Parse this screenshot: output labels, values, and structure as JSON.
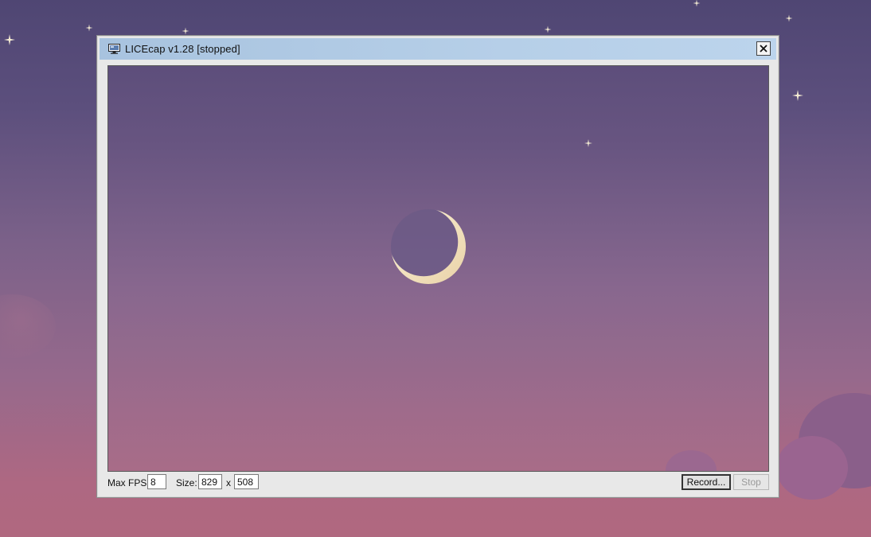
{
  "window": {
    "title": "LICEcap v1.28 [stopped]"
  },
  "controls": {
    "max_fps_label": "Max FPS:",
    "max_fps_value": "8",
    "size_label": "Size:",
    "width_value": "829",
    "times_label": "x",
    "height_value": "508",
    "record_label": "Record...",
    "stop_label": "Stop"
  },
  "icons": {
    "app": "monitor-icon",
    "close": "close-icon",
    "moon": "crescent-moon",
    "stars": "sparkle-star"
  },
  "colors": {
    "titlebar": "#b6cfe8",
    "window_frame": "#e8e8e8",
    "moon_light": "#f4e6c4",
    "sky_top": "#4f4673",
    "sky_bottom": "#b0687f"
  }
}
